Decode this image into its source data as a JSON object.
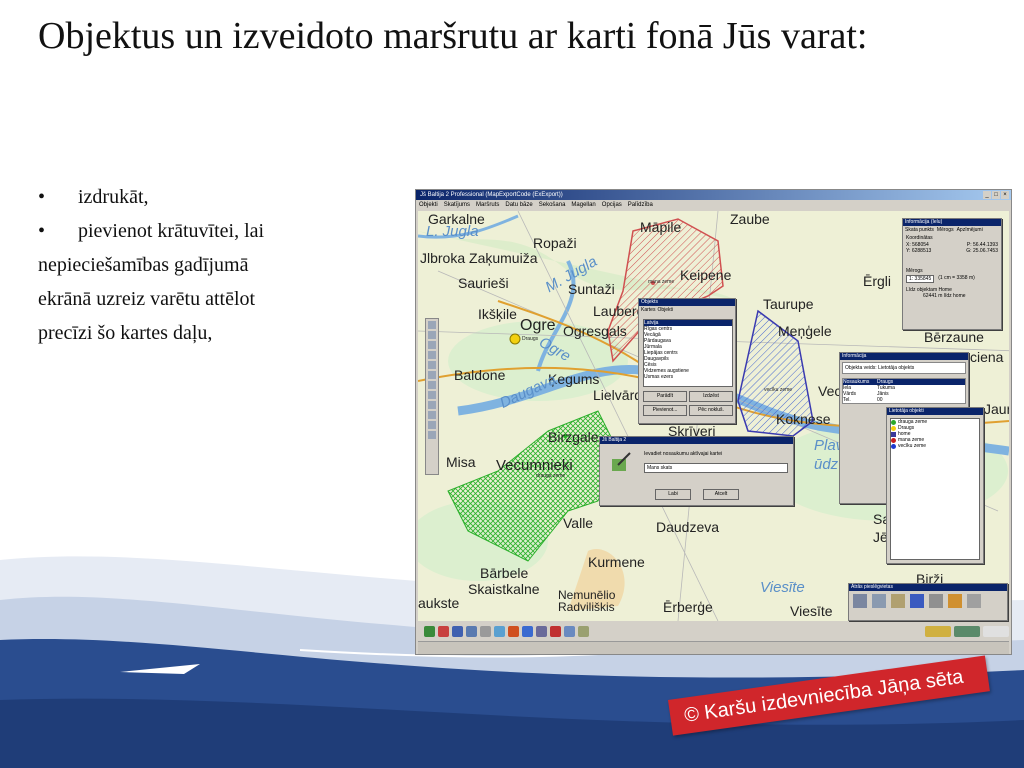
{
  "slide": {
    "title": "Objektus un izveidoto maršrutu ar karti fonā Jūs varat:",
    "bullets": [
      "izdrukāt,",
      "pievienot krātuvītei, lai"
    ],
    "bullet_symbol": "•",
    "continuation": [
      "nepieciešamības gadījumā",
      "ekrānā uzreiz varētu attēlot",
      "precīzi šo kartes daļu,"
    ],
    "copyright": "© Karšu izdevniecība Jāņa sēta"
  },
  "app": {
    "title": "Jš Baltija 2 Professional (MapExportCode (ExExport))",
    "menu": [
      "Objekti",
      "Skatījums",
      "Maršruts",
      "Datu bāze",
      "Sekošana",
      "Magellan",
      "Opcijas",
      "Palīdzība"
    ],
    "window_buttons": [
      "_",
      "□",
      "×"
    ]
  },
  "map": {
    "places": [
      {
        "label": "Garkalne",
        "id": "garkalne"
      },
      {
        "label": "Māpile",
        "id": "mapile"
      },
      {
        "label": "Zaube",
        "id": "zaube"
      },
      {
        "label": "Ropaži",
        "id": "ropazi"
      },
      {
        "label": "Jlbroka Zaķumuiža",
        "id": "zakumuiza"
      },
      {
        "label": "Saurieši",
        "id": "saurieso"
      },
      {
        "label": "Suntaži",
        "id": "suntazi"
      },
      {
        "label": "Keipene",
        "id": "keipene"
      },
      {
        "label": "Ērgli",
        "id": "ergli"
      },
      {
        "label": "Laubere",
        "id": "laubere"
      },
      {
        "label": "Taurupe",
        "id": "taurupe"
      },
      {
        "label": "Ikšķile",
        "id": "ikskile"
      },
      {
        "label": "Ogre",
        "id": "ogre"
      },
      {
        "label": "Ogresgals",
        "id": "ogresgals"
      },
      {
        "label": "Meņģele",
        "id": "mengele"
      },
      {
        "label": "Baldone",
        "id": "baldone"
      },
      {
        "label": "Ķegums",
        "id": "kegums"
      },
      {
        "label": "Lielvārde",
        "id": "lielvarde"
      },
      {
        "label": "Vec",
        "id": "vec"
      },
      {
        "label": "Koknese",
        "id": "koknese"
      },
      {
        "label": "Skrīveri",
        "id": "skriveri"
      },
      {
        "label": "Birzgale",
        "id": "birzgale"
      },
      {
        "label": "Misa",
        "id": "misa"
      },
      {
        "label": "Vecumnieki",
        "id": "vecumnieki"
      },
      {
        "label": "Valle",
        "id": "valle"
      },
      {
        "label": "Daudzeva",
        "id": "daudzeva"
      },
      {
        "label": "Kurmene",
        "id": "kurmene"
      },
      {
        "label": "Bārbele",
        "id": "barbele"
      },
      {
        "label": "Skaistkalne",
        "id": "skaistkalne"
      },
      {
        "label": "aukste",
        "id": "aukste"
      },
      {
        "label": "Nemunēlio Radviliškis",
        "id": "nemunelis"
      },
      {
        "label": "Ērberģe",
        "id": "erberge"
      },
      {
        "label": "Viesīte",
        "id": "viesite"
      },
      {
        "label": "Birži",
        "id": "birzi"
      },
      {
        "label": "Bērzaune",
        "id": "berzaune"
      },
      {
        "label": "Jaun",
        "id": "jaun"
      },
      {
        "label": "Sa",
        "id": "sa"
      },
      {
        "label": "Jē",
        "id": "je"
      },
      {
        "label": "ciena",
        "id": "ciena"
      }
    ],
    "rivers": [
      "L. Jugla",
      "M. Jugla",
      "Ogre",
      "Daugava",
      "Viesīte",
      "Plav",
      "ūdz"
    ],
    "annotations": {
      "mana_zeme": "mana zeme",
      "draugs": "Draugs",
      "drauga_zeme": "drauga zeme",
      "veciku_zeme": "vecīku zeme"
    }
  },
  "dialogs": {
    "objects": {
      "title": "Objekts",
      "tabs": [
        "Kartes",
        "Objekti"
      ],
      "items": [
        "Latvija",
        "Rīgas centrs",
        "Vecāgā",
        "Pārdaugava",
        "Jūrmala",
        "Liepājas centrs",
        "Daugavpils",
        "Cēsis",
        "Vidzemes augstiene",
        "Usmas ezers"
      ],
      "buttons": [
        "Parādīt",
        "Izdzēst",
        "Pievienot...",
        "Pēc nokluš."
      ]
    },
    "location": {
      "title": "Informācija (Ielu)",
      "tabs": [
        "Skata punkts",
        "Mērogs",
        "Apzīmējumi"
      ],
      "coords_label": "Koordinātas",
      "x": "X: 568054",
      "y": "Y: 6288513",
      "p": "P: 56.44.1393",
      "g": "G: 25.06.7453",
      "scale_label": "Mērogs",
      "scale_value": "1: 335845",
      "scale_note": "(1 cm = 3358 m)",
      "distance_label": "Līdz objektam Home",
      "distance_value": "62441 m līdz home"
    },
    "info": {
      "title": "Informācija",
      "type_label": "Objekta veids: Lietotāja objekts",
      "rows": [
        [
          "Nosaukums",
          "Draugs"
        ],
        [
          "Iela",
          "Tukuma"
        ],
        [
          "Vārds",
          "Jānis"
        ],
        [
          "Tel.",
          "00"
        ]
      ]
    },
    "legend": {
      "title": "Lietotāja objekti",
      "items": [
        {
          "label": "drauga zeme",
          "color": "#2aa82a"
        },
        {
          "label": "Draugs",
          "color": "#f2d010"
        },
        {
          "label": "home",
          "color": "#3a3a9a"
        },
        {
          "label": "mana zeme",
          "color": "#c81e1e"
        },
        {
          "label": "vecīku zeme",
          "color": "#1e3ad0"
        }
      ]
    },
    "prompt": {
      "title": "Jš Baltija 2",
      "message": "Ievadiet nosaukumu aktīvajai kartei",
      "value": "Mans skats",
      "buttons": [
        "Labi",
        "Atcelt"
      ]
    },
    "quick_panel": {
      "title": "Ātrās pieslēgvietas"
    }
  },
  "colors": {
    "accent_red": "#d0262b",
    "wave_blue": "#2a4d8f",
    "title_bar": "#0a246a",
    "window": "#d4d0c8"
  }
}
